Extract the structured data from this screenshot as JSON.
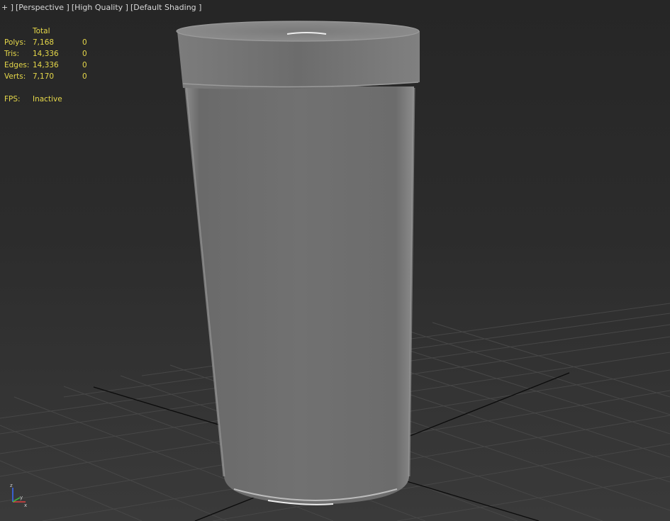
{
  "viewport": {
    "labels": {
      "plus": "+ ]",
      "view": "[Perspective ]",
      "quality": "[High Quality ]",
      "shading": "[Default Shading ]"
    },
    "stats": {
      "header": "Total",
      "rows": [
        {
          "key": "Polys:",
          "total": "7,168",
          "selected": "0"
        },
        {
          "key": "Tris:",
          "total": "14,336",
          "selected": "0"
        },
        {
          "key": "Edges:",
          "total": "14,336",
          "selected": "0"
        },
        {
          "key": "Verts:",
          "total": "7,170",
          "selected": "0"
        }
      ],
      "fps_key": "FPS:",
      "fps_value": "Inactive"
    },
    "gizmo": {
      "z": "z",
      "y": "y",
      "x": "x"
    }
  },
  "colors": {
    "stats_text": "#e6d84a",
    "label_text": "#d8d8d8",
    "grid_line": "#4a4a4a",
    "axis_line": "#0a0a0a",
    "object_base": "#6e6e6e"
  },
  "icons": [
    "axis-gizmo-icon"
  ]
}
